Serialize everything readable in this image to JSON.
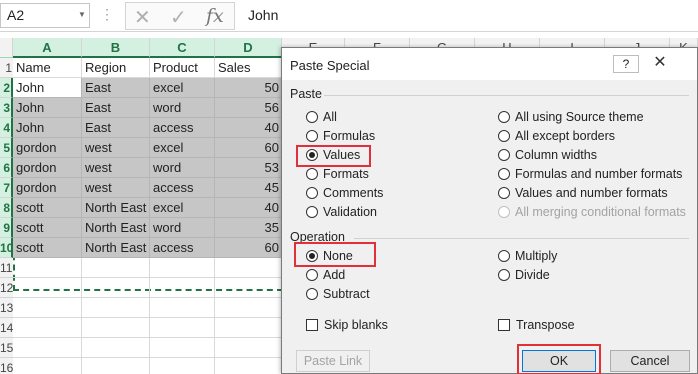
{
  "formula_bar": {
    "name_box": "A2",
    "dots": "⋮",
    "cancel_icon": "✕",
    "enter_icon": "✓",
    "fx_label": "fx",
    "content": "John"
  },
  "sheet": {
    "columns": [
      "A",
      "B",
      "C",
      "D",
      "E",
      "F",
      "G",
      "H",
      "I",
      "J",
      "K"
    ],
    "rows": [
      "1",
      "2",
      "3",
      "4",
      "5",
      "6",
      "7",
      "8",
      "9",
      "10",
      "11",
      "12",
      "13",
      "14",
      "15",
      "16"
    ],
    "header_row": [
      "Name",
      "Region",
      "Product",
      "Sales"
    ],
    "data": [
      [
        "John",
        "East",
        "excel",
        "50"
      ],
      [
        "John",
        "East",
        "word",
        "56"
      ],
      [
        "John",
        "East",
        "access",
        "40"
      ],
      [
        "gordon",
        "west",
        "excel",
        "60"
      ],
      [
        "gordon",
        "west",
        "word",
        "53"
      ],
      [
        "gordon",
        "west",
        "access",
        "45"
      ],
      [
        "scott",
        "North East",
        "excel",
        "40"
      ],
      [
        "scott",
        "North East",
        "word",
        "35"
      ],
      [
        "scott",
        "North East",
        "access",
        "60"
      ]
    ]
  },
  "dialog": {
    "title": "Paste Special",
    "help_label": "?",
    "close_icon": "✕",
    "paste_label": "Paste",
    "paste_options_left": [
      "All",
      "Formulas",
      "Values",
      "Formats",
      "Comments",
      "Validation"
    ],
    "paste_options_right": [
      "All using Source theme",
      "All except borders",
      "Column widths",
      "Formulas and number formats",
      "Values and number formats",
      "All merging conditional formats"
    ],
    "paste_selected": "Values",
    "operation_label": "Operation",
    "operation_left": [
      "None",
      "Add",
      "Subtract"
    ],
    "operation_right": [
      "Multiply",
      "Divide"
    ],
    "operation_selected": "None",
    "skip_blanks": "Skip blanks",
    "transpose": "Transpose",
    "paste_link": "Paste Link",
    "ok": "OK",
    "cancel": "Cancel"
  },
  "colors": {
    "excel_green": "#217346",
    "selection_gray": "#c6c6c6",
    "highlight_red": "#e0303a"
  }
}
